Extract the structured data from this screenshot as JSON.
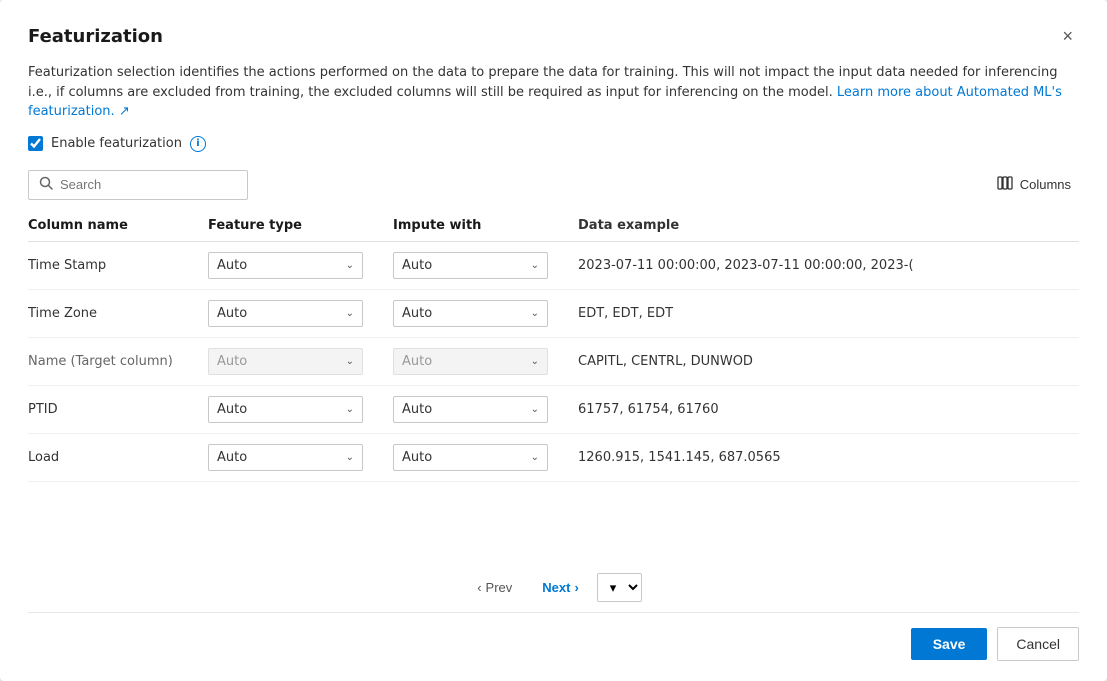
{
  "dialog": {
    "title": "Featurization",
    "close_label": "×"
  },
  "description": {
    "text": "Featurization selection identifies the actions performed on the data to prepare the data for training. This will not impact the input data needed for inferencing i.e., if columns are excluded from training, the excluded columns will still be required as input for inferencing on the model.",
    "link_text": "Learn more about Automated ML's featurization.",
    "link_icon": "↗"
  },
  "enable_featurization": {
    "label": "Enable featurization",
    "checked": true
  },
  "search": {
    "placeholder": "Search"
  },
  "columns_button": {
    "label": "Columns"
  },
  "table": {
    "headers": [
      "Column name",
      "Feature type",
      "Impute with",
      "Data example"
    ],
    "rows": [
      {
        "column_name": "Time Stamp",
        "feature_type": "Auto",
        "impute_with": "Auto",
        "data_example": "2023-07-11 00:00:00, 2023-07-11 00:00:00, 2023-(",
        "disabled": false
      },
      {
        "column_name": "Time Zone",
        "feature_type": "Auto",
        "impute_with": "Auto",
        "data_example": "EDT, EDT, EDT",
        "disabled": false
      },
      {
        "column_name": "Name (Target column)",
        "feature_type": "Auto",
        "impute_with": "Auto",
        "data_example": "CAPITL, CENTRL, DUNWOD",
        "disabled": true
      },
      {
        "column_name": "PTID",
        "feature_type": "Auto",
        "impute_with": "Auto",
        "data_example": "61757, 61754, 61760",
        "disabled": false
      },
      {
        "column_name": "Load",
        "feature_type": "Auto",
        "impute_with": "Auto",
        "data_example": "1260.915, 1541.145, 687.0565",
        "disabled": false
      }
    ]
  },
  "pagination": {
    "prev_label": "Prev",
    "next_label": "Next"
  },
  "footer": {
    "save_label": "Save",
    "cancel_label": "Cancel"
  }
}
